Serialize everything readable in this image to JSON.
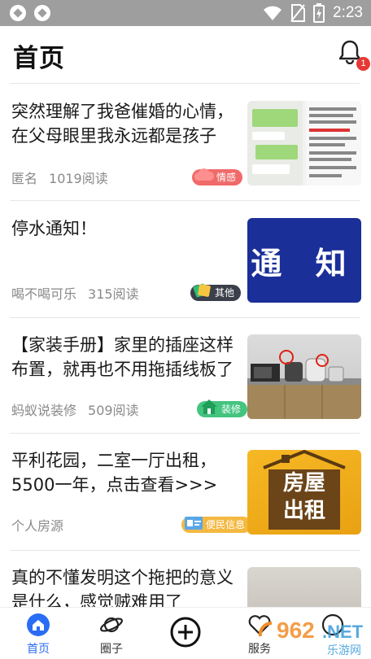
{
  "status_bar": {
    "time": "2:23"
  },
  "header": {
    "title": "首页",
    "notification_count": "1"
  },
  "posts": [
    {
      "title": "突然理解了我爸催婚的心情，在父母眼里我永远都是孩子",
      "author": "匿名",
      "reads": "1019阅读",
      "tag": "情感",
      "tag_color": "#f06a6a"
    },
    {
      "title": "停水通知！",
      "author": "喝不喝可乐",
      "reads": "315阅读",
      "tag": "其他",
      "tag_color": "#3b3f4a",
      "thumb_text": "通 知"
    },
    {
      "title": "【家装手册】家里的插座这样布置，就再也不用拖插线板了",
      "author": "蚂蚁说装修",
      "reads": "509阅读",
      "tag": "装修",
      "tag_color": "#43c47f"
    },
    {
      "title": "平利花园，二室一厅出租，5500一年，点击查看>>>",
      "author": "个人房源",
      "reads": "",
      "tag": "便民信息",
      "tag_color": "#f4b942",
      "thumb_text_1": "房屋",
      "thumb_text_2": "出租"
    },
    {
      "title": "真的不懂发明这个拖把的意义是什么，感觉贼难用了"
    }
  ],
  "tabbar": {
    "home": "首页",
    "circle": "圈子",
    "add": "",
    "services": "服务",
    "me": ""
  },
  "watermark": {
    "text": "962.NET",
    "sub": "乐游网"
  },
  "colors": {
    "accent": "#2a6df4",
    "badge": "#e53935"
  }
}
